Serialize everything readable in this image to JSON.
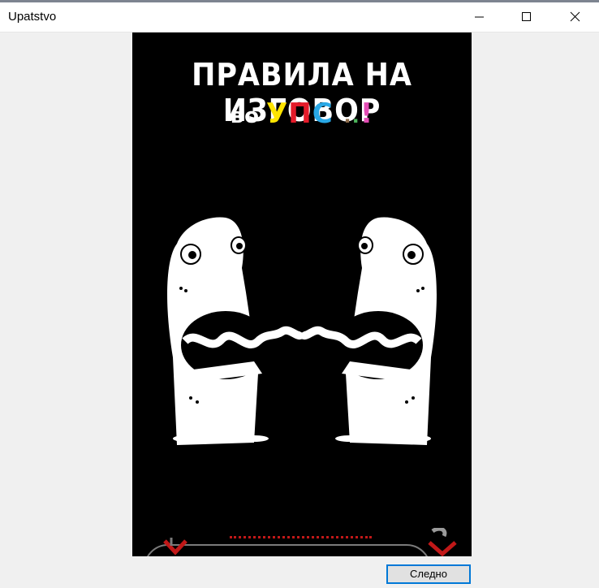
{
  "window": {
    "title": "Upatstvo",
    "controls": [
      "minimize-icon",
      "maximize-icon",
      "close-icon"
    ]
  },
  "image": {
    "heading": "ПРАВИЛА НА ИЗГОВОР",
    "subtitle": {
      "prefix": "во",
      "u": "У",
      "p": "П",
      "s": "С",
      "dot1": ".",
      "dot2": ".",
      "bang": "!"
    },
    "colors": {
      "yellow": "#ffe400",
      "red": "#e41b2a",
      "blue": "#29a8e6",
      "pink": "#e24cb4"
    }
  },
  "footer": {
    "next_label": "Следно"
  }
}
